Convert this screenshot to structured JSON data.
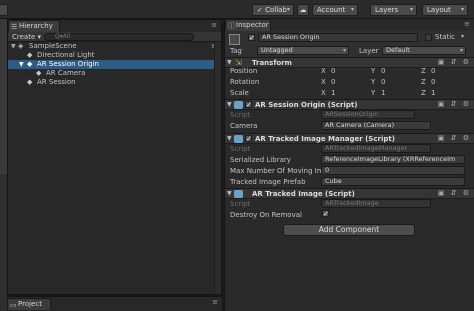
{
  "toolbar": {
    "collab": "Collab",
    "account": "Account",
    "layers": "Layers",
    "layout": "Layout",
    "cloud_icon": "cloud-icon"
  },
  "hierarchy": {
    "tab_label": "Hierarchy",
    "create_label": "Create",
    "search_placeholder": "Q▾All",
    "scene_name": "SampleScene",
    "items": [
      {
        "label": "Directional Light",
        "depth": 1,
        "selected": false
      },
      {
        "label": "AR Session Origin",
        "depth": 1,
        "selected": true
      },
      {
        "label": "AR Camera",
        "depth": 2,
        "selected": false
      },
      {
        "label": "AR Session",
        "depth": 1,
        "selected": false
      }
    ]
  },
  "project": {
    "tab_label": "Project"
  },
  "inspector": {
    "tab_label": "Inspector",
    "object_name": "AR Session Origin",
    "static_label": "Static",
    "tag_label": "Tag",
    "tag_value": "Untagged",
    "layer_label": "Layer",
    "layer_value": "Default",
    "transform": {
      "title": "Transform",
      "rows": [
        {
          "label": "Position",
          "x": "0",
          "y": "0",
          "z": "0"
        },
        {
          "label": "Rotation",
          "x": "0",
          "y": "0",
          "z": "0"
        },
        {
          "label": "Scale",
          "x": "1",
          "y": "1",
          "z": "1"
        }
      ]
    },
    "session_origin": {
      "title": "AR Session Origin (Script)",
      "script_label": "Script",
      "script_value": "ARSessionOrigin",
      "camera_label": "Camera",
      "camera_value": "AR Camera (Camera)"
    },
    "image_manager": {
      "title": "AR Tracked Image Manager (Script)",
      "script_label": "Script",
      "script_value": "ARTrackedImageManager",
      "library_label": "Serialized Library",
      "library_value": "ReferenceImageLibrary (XRReferenceIm",
      "max_label": "Max Number Of Moving Im",
      "max_value": "0",
      "prefab_label": "Tracked Image Prefab",
      "prefab_value": "Cube"
    },
    "tracked_image": {
      "title": "AR Tracked Image (Script)",
      "script_label": "Script",
      "script_value": "ARTrackedImage",
      "destroy_label": "Destroy On Removal",
      "destroy_checked": true
    },
    "add_component": "Add Component"
  },
  "colors": {
    "selection": "#2c5d87",
    "panel_bg": "#282828",
    "header_bg": "#353535"
  }
}
